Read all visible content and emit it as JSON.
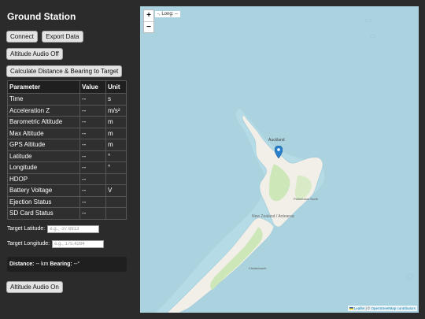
{
  "app": {
    "title": "Ground Station"
  },
  "toolbar": {
    "connect_label": "Connect",
    "export_label": "Export Data",
    "altitude_audio_top_label": "Altitude Audio Off",
    "calc_label": "Calculate Distance & Bearing to Target"
  },
  "table": {
    "headers": [
      "Parameter",
      "Value",
      "Unit"
    ],
    "rows": [
      {
        "param": "Time",
        "value": "--",
        "unit": "s"
      },
      {
        "param": "Acceleration Z",
        "value": "--",
        "unit": "m/s²"
      },
      {
        "param": "Barometric Altitude",
        "value": "--",
        "unit": "m"
      },
      {
        "param": "Max Altitude",
        "value": "--",
        "unit": "m"
      },
      {
        "param": "GPS Altitude",
        "value": "--",
        "unit": "m"
      },
      {
        "param": "Latitude",
        "value": "--",
        "unit": "°"
      },
      {
        "param": "Longitude",
        "value": "--",
        "unit": "°"
      },
      {
        "param": "HDOP",
        "value": "--",
        "unit": ""
      },
      {
        "param": "Battery Voltage",
        "value": "--",
        "unit": "V"
      },
      {
        "param": "Ejection Status",
        "value": "--",
        "unit": ""
      },
      {
        "param": "SD Card Status",
        "value": "--",
        "unit": ""
      }
    ]
  },
  "target": {
    "lat_label": "Target Latitude:",
    "lat_placeholder": "e.g., -37.6913",
    "lat_value": "",
    "lon_label": "Target Longitude:",
    "lon_placeholder": "e.g., 175.4284",
    "lon_value": ""
  },
  "result": {
    "distance_label": "Distance:",
    "distance_value": "-- km",
    "bearing_label": "Bearing:",
    "bearing_value": "--°"
  },
  "bottom": {
    "altitude_audio_label": "Altitude Audio On"
  },
  "map": {
    "zoom_in": "+",
    "zoom_out": "−",
    "coords": "-, Long: --",
    "attribution_leaflet": "Leaflet",
    "attribution_sep": " | © ",
    "attribution_osm": "OpenStreetMap contributors",
    "marker_icon": "map-marker-icon",
    "place_labels": [
      "Auckland",
      "New Zealand / Aotearoa",
      "Palmerston North",
      "Christchurch"
    ],
    "colors": {
      "sea": "#aad3df",
      "land": "#f2efe9",
      "green": "#cde7b9",
      "marker": "#2a81cb"
    }
  }
}
